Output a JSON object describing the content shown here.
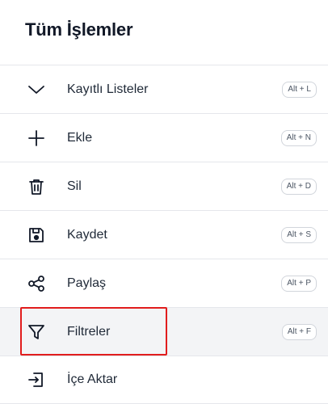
{
  "header": {
    "title": "Tüm İşlemler"
  },
  "items": [
    {
      "label": "Kayıtlı Listeler",
      "shortcut": "Alt + L",
      "icon": "chevron-down-icon"
    },
    {
      "label": "Ekle",
      "shortcut": "Alt + N",
      "icon": "plus-icon"
    },
    {
      "label": "Sil",
      "shortcut": "Alt + D",
      "icon": "trash-icon"
    },
    {
      "label": "Kaydet",
      "shortcut": "Alt + S",
      "icon": "save-icon"
    },
    {
      "label": "Paylaş",
      "shortcut": "Alt + P",
      "icon": "share-icon"
    },
    {
      "label": "Filtreler",
      "shortcut": "Alt + F",
      "icon": "filter-icon"
    },
    {
      "label": "İçe Aktar",
      "shortcut": "",
      "icon": "import-icon"
    }
  ],
  "colors": {
    "highlight": "#e11d1d",
    "active_row": "#f3f4f6"
  }
}
